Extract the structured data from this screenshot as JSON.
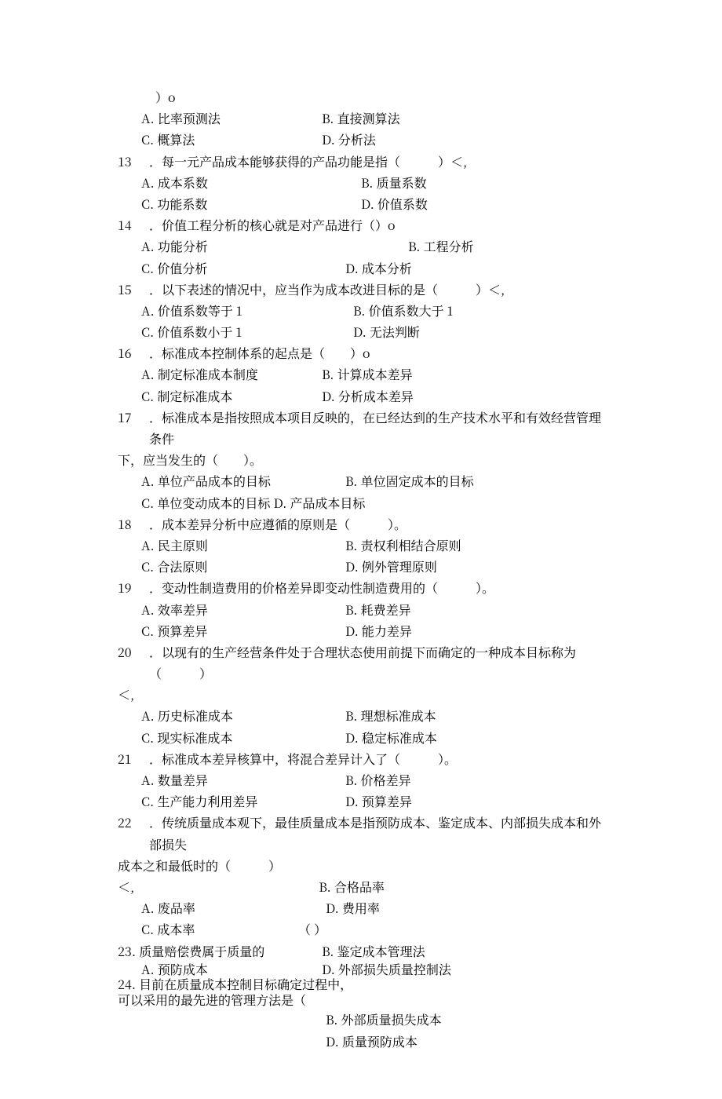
{
  "intro_tail": "）o",
  "q12": {
    "A": "A. 比率预测法",
    "B": "B. 直接测算法",
    "C": "C. 概算法",
    "D": "D. 分析法"
  },
  "q13": {
    "num": "13",
    "stem": "．每一元产品成本能够获得的产品功能是指（　　　）＜,",
    "A": "A. 成本系数",
    "B": "B. 质量系数",
    "C": "C. 功能系数",
    "D": "D. 价值系数"
  },
  "q14": {
    "num": "14",
    "stem": "．价值工程分析的核心就是对产品进行（）o",
    "A": "A. 功能分析",
    "B": "B. 工程分析",
    "C": "C. 价值分析",
    "D": "D. 成本分析"
  },
  "q15": {
    "num": "15",
    "stem": "．以下表述的情况中，应当作为成本改进目标的是（　　　）＜,",
    "A": "A. 价值系数等于 1",
    "B": "B. 价值系数大于 1",
    "C": "C. 价值系数小于 1",
    "D": "D. 无法判断"
  },
  "q16": {
    "num": "16",
    "stem": "．标准成本控制体系的起点是（　　）o",
    "A": "A. 制定标准成本制度",
    "B": "B. 计算成本差异",
    "C": "C. 制定标准成本",
    "D": "D. 分析成本差异"
  },
  "q17": {
    "num": "17",
    "stem": "．标准成本是指按照成本项目反映的，在已经达到的生产技术水平和有效经营管理条件",
    "stem2": "下，应当发生的（　　）。",
    "A": "A. 单位产品成本的目标",
    "B": "B. 单位固定成本的目标",
    "CD": "C. 单位变动成本的目标 D. 产品成本目标"
  },
  "q18": {
    "num": "18",
    "stem": "．成本差异分析中应遵循的原则是（　　　）。",
    "A": "A. 民主原则",
    "B": "B. 责权利相结合原则",
    "C": "C. 合法原则",
    "D": "D. 例外管理原则"
  },
  "q19": {
    "num": "19",
    "stem": "．变动性制造费用的价格差异即变动性制造费用的（　　　）。",
    "A": "A. 效率差异",
    "B": "B. 耗费差异",
    "C": "C. 预算差异",
    "D": "D. 能力差异"
  },
  "q20": {
    "num": "20",
    "stem": "．以现有的生产经营条件处于合理状态使用前提下而确定的一种成本目标称为（　　　）",
    "stem2": "＜,",
    "A": "A. 历史标准成本",
    "B": "B. 理想标准成本",
    "C": "C. 现实标准成本",
    "D": "D. 稳定标准成本"
  },
  "q21": {
    "num": "21",
    "stem": "．标准成本差异核算中，将混合差异计入了（　　　）。",
    "A": "A. 数量差异",
    "B": "B. 价格差异",
    "C": "C. 生产能力利用差异",
    "D": "D. 预算差异"
  },
  "q22": {
    "num": "22",
    "stem": "．传统质量成本观下，最佳质量成本是指预防成本、鉴定成本、内部损失成本和外部损失",
    "stem2": "成本之和最低时的（　　　）",
    "stem3": "＜,",
    "A": "A. 废品率",
    "B": "B. 合格品率",
    "C": "C. 成本率",
    "D": "D. 费用率"
  },
  "q23": {
    "num": "23.",
    "stem": "质量赔偿费属于质量的",
    "left1": "A. 预防成本",
    "left2": "24. 目前在质量成本控制目标确定过程中，",
    "left3": "可以采用的最先进的管理方法是（",
    "r_paren": "（ ）",
    "r1": "B. 鉴定成本管理法",
    "r2": "D. 外部损失质量控制法",
    "r3": "B. 外部质量损失成本",
    "r4": "D. 质量预防成本"
  }
}
